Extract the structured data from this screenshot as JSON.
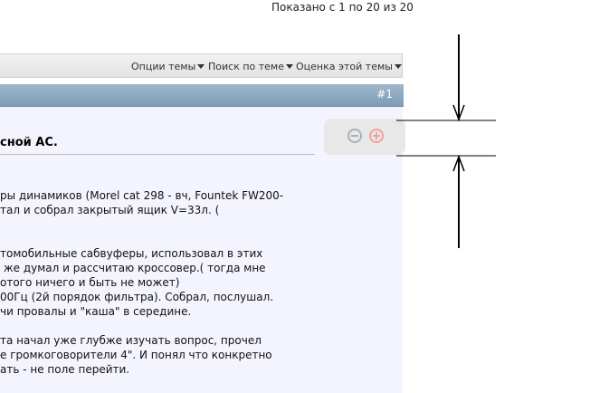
{
  "pager": {
    "text": "Показано с 1 по 20 из 20"
  },
  "toolbar": {
    "thread_options": "Опции темы",
    "thread_search": "Поиск по теме",
    "thread_rating": "Оценка этой темы"
  },
  "post": {
    "number": "#1",
    "title": "сной АС.",
    "lines": [
      "ры динамиков (Morel cat 298 - вч, Fountek FW200-",
      "тал и собрал закрытый ящик V=33л. (",
      "",
      "",
      "томобильные сабвуферы, использовал в этих",
      " же думал и рассчитаю кроссовер.( тогда мне",
      "отого ничего и быть не может)",
      "00Гц (2й порядок фильтра). Собрал, послушал.",
      "чи провалы и \"каша\" в середине.",
      "",
      "та начал уже глубже изучать вопрос, прочел",
      "е громкоговорители 4\". И понял что конкретно",
      "ать - не поле перейти."
    ]
  },
  "zoom": {
    "minus_icon": "zoom-out-icon",
    "plus_icon": "zoom-in-icon"
  },
  "colors": {
    "post_header": "#8ba8c0",
    "post_background": "#f4f4ff",
    "toolbar": "#e8e8e8"
  }
}
